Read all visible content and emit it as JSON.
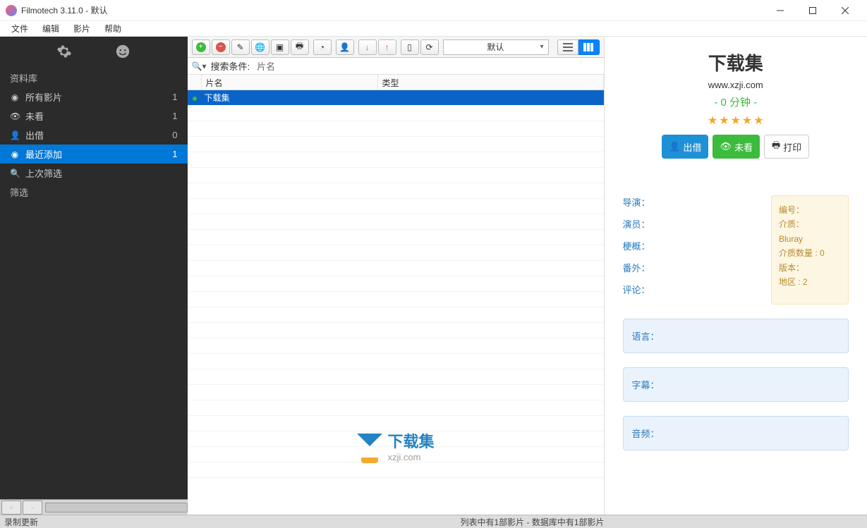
{
  "window": {
    "title": "Filmotech 3.11.0 - 默认"
  },
  "menu": {
    "file": "文件",
    "edit": "编辑",
    "movie": "影片",
    "help": "帮助"
  },
  "sidebar": {
    "section_library": "资料库",
    "section_filter": "筛选",
    "items": [
      {
        "icon": "●",
        "label": "所有影片",
        "count": "1"
      },
      {
        "icon": "eye",
        "label": "未看",
        "count": "1"
      },
      {
        "icon": "person",
        "label": "出借",
        "count": "0"
      },
      {
        "icon": "●",
        "label": "最近添加",
        "count": "1"
      },
      {
        "icon": "search",
        "label": "上次筛选",
        "count": ""
      }
    ]
  },
  "toolbar": {
    "select_label": "默认"
  },
  "search": {
    "label": "搜索条件:",
    "field": "片名"
  },
  "table": {
    "col_name": "片名",
    "col_type": "类型",
    "row0_name": "下载集"
  },
  "watermark": {
    "text": "下载集",
    "sub": "xzji.com"
  },
  "details": {
    "title": "下载集",
    "url": "www.xzji.com",
    "duration": "- 0 分钟 -",
    "btn_lend": "出借",
    "btn_unseen": "未看",
    "btn_print": "打印",
    "left": {
      "director": "导演：",
      "actors": "演员：",
      "synopsis": "梗概：",
      "bonus": "番外：",
      "comments": "评论："
    },
    "right": {
      "id_label": "编号：",
      "media_label": "介质：",
      "media_value": "Bluray",
      "media_count_label": "介质数量 :",
      "media_count_value": " 0",
      "version_label": "版本：",
      "region_label": "地区 :",
      "region_value": " 2"
    },
    "panels": {
      "language": "语言：",
      "subtitle": "字幕：",
      "audio": "音频："
    }
  },
  "status": {
    "left": "录制更新",
    "center": "列表中有1部影片 - 数据库中有1部影片"
  }
}
